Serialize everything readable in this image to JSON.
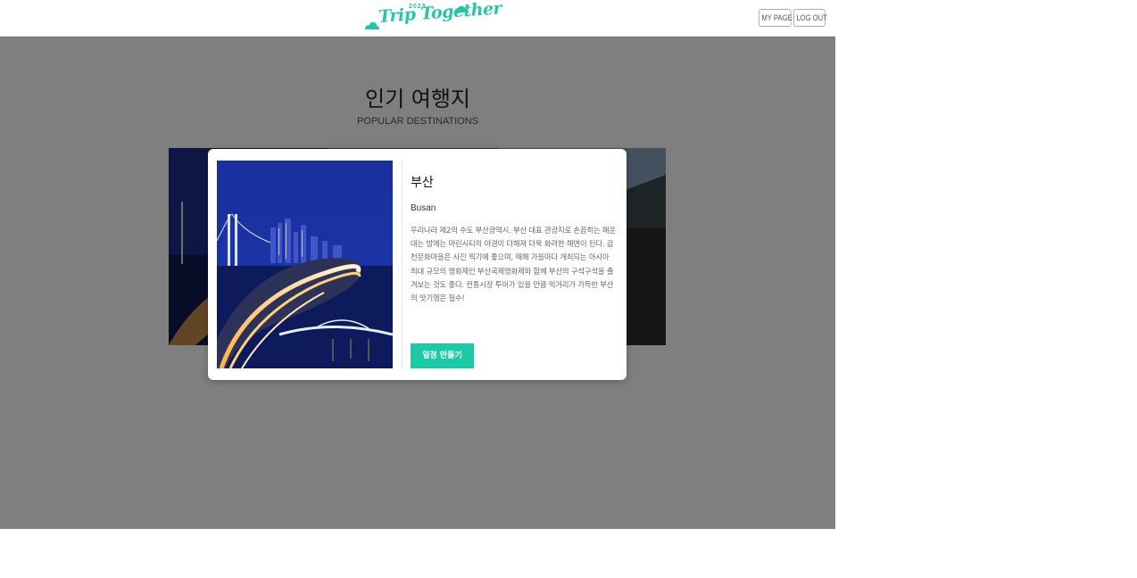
{
  "header": {
    "logo_year": "2023",
    "logo_text": "Trip Together",
    "my_page_label": "MY PAGE",
    "logout_label": "LOG OUT"
  },
  "section": {
    "title": "인기 여행지",
    "subtitle": "POPULAR DESTINATIONS"
  },
  "modal": {
    "title": "부산",
    "subtitle": "Busan",
    "description": "우리나라 제2의 수도 부산광역시. 부산 대표 관광지로 손꼽히는 해운대는 밤에는 마린시티의 야경이 더해져 더욱 화려한 해변이 된다. 감천문화마을은 사진 찍기에 좋으며, 매해 가을마다 개최되는 아시아 최대 규모의 영화제인 부산국제영화제와 함께 부산의 구석구석을 즐겨보는 것도 좋다. 전통시장 투어가 있을 만큼 먹거리가 가득한 부산의 맛기행은 필수!",
    "button_label": "일정 만들기"
  },
  "colors": {
    "accent": "#1ccba6",
    "overlay": "rgba(0,0,0,0.5)"
  },
  "icons": {
    "logo_cloud": "cloud-icon"
  }
}
